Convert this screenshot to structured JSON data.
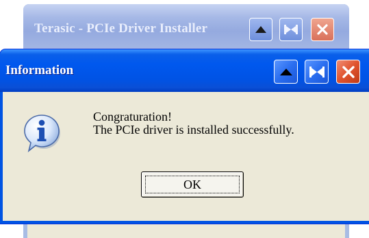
{
  "background_window": {
    "title": "Terasic - PCIe Driver Installer",
    "buttons": [
      {
        "icon": "up-arrow-icon"
      },
      {
        "icon": "pin-icon"
      },
      {
        "icon": "close-icon"
      }
    ]
  },
  "dialog": {
    "title": "Information",
    "icon": "information-icon",
    "message_line1": "Congraturation!",
    "message_line2": "The PCIe driver is installed successfully.",
    "ok_label": "OK",
    "buttons": [
      {
        "icon": "up-arrow-icon"
      },
      {
        "icon": "pin-icon"
      },
      {
        "icon": "close-icon"
      }
    ]
  },
  "colors": {
    "titlebar_active": "#0054e3",
    "titlebar_inactive": "#a5b8e6",
    "dialog_face": "#ece9d8",
    "close_button": "#e0532e"
  }
}
